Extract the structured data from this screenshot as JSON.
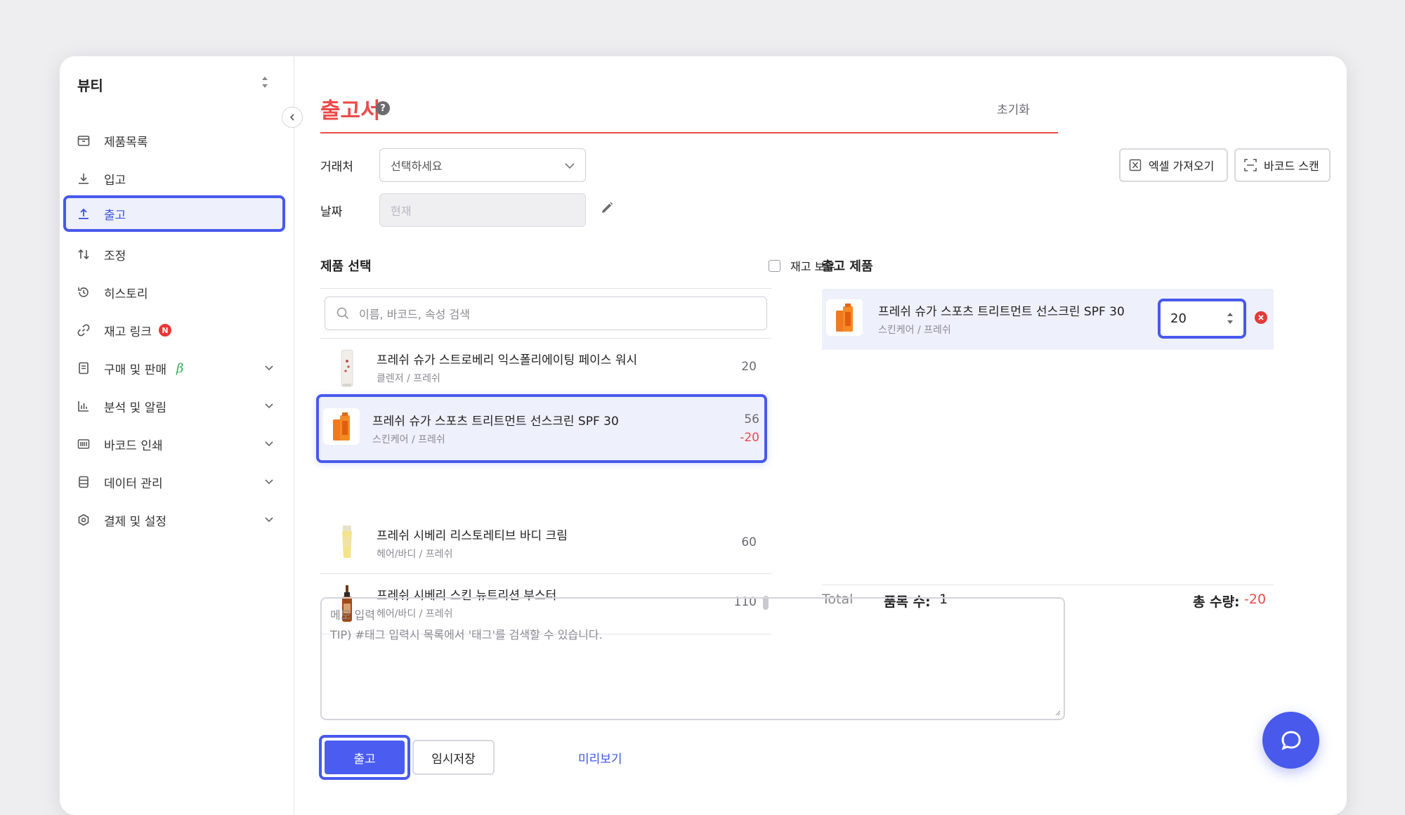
{
  "sidebar": {
    "workspace": "뷰티",
    "items": [
      {
        "label": "제품목록",
        "icon": "box-icon"
      },
      {
        "label": "입고",
        "icon": "download-icon"
      },
      {
        "label": "출고",
        "icon": "upload-icon",
        "active": true
      },
      {
        "label": "조정",
        "icon": "adjust-icon"
      },
      {
        "label": "히스토리",
        "icon": "history-icon"
      },
      {
        "label": "재고 링크",
        "icon": "link-icon",
        "badge": "N"
      },
      {
        "label": "구매 및 판매",
        "icon": "receipt-icon",
        "beta": "β"
      },
      {
        "label": "분석 및 알림",
        "icon": "chart-icon"
      },
      {
        "label": "바코드 인쇄",
        "icon": "barcode-icon"
      },
      {
        "label": "데이터 관리",
        "icon": "database-icon"
      },
      {
        "label": "결제 및 설정",
        "icon": "gear-icon"
      }
    ]
  },
  "header": {
    "title": "출고서",
    "help": "?",
    "reset": "초기화"
  },
  "form": {
    "vendor_label": "거래처",
    "vendor_value": "선택하세요",
    "date_label": "날짜",
    "date_value": "현재",
    "excel_button": "엑셀 가져오기",
    "barcode_button": "바코드 스캔"
  },
  "product_select": {
    "title": "제품 선택",
    "in_stock_label": "재고 보유",
    "search_placeholder": "이름, 바코드, 속성 검색",
    "products": [
      {
        "name": "프레쉬 슈가 스트로베리 익스폴리에이팅 페이스 워시",
        "category": "클렌저 / 프레쉬",
        "qty": "20"
      },
      {
        "name": "프레쉬 슈가 스포츠 트리트먼트 선스크린 SPF 30",
        "category": "스킨케어 / 프레쉬",
        "qty": "56",
        "delta": "-20"
      },
      {
        "name": "프레쉬 시베리 리스토레티브 바디 크림",
        "category": "헤어/바디 / 프레쉬",
        "qty": "60"
      },
      {
        "name": "프레쉬 시베리 스킨 뉴트리션 부스터",
        "category": "헤어/바디 / 프레쉬",
        "qty": "110"
      }
    ]
  },
  "outbound": {
    "title": "출고 제품",
    "item": {
      "name": "프레쉬 슈가 스포츠 트리트먼트 선스크린 SPF 30",
      "category": "스킨케어 / 프레쉬",
      "qty": "20"
    },
    "total_label": "Total",
    "item_count_label": "품목 수:",
    "item_count": "1",
    "total_qty_label": "총 수량:",
    "total_qty": "-20"
  },
  "memo": {
    "line1": "메모 입력",
    "line2": "TIP) #태그 입력시 목록에서 '태그'를 검색할 수 있습니다."
  },
  "actions": {
    "submit": "출고",
    "draft": "임시저장",
    "preview": "미리보기"
  },
  "colors": {
    "accent": "#4859ec",
    "danger": "#ec4b4b",
    "brand_title": "#ec4b4b"
  }
}
